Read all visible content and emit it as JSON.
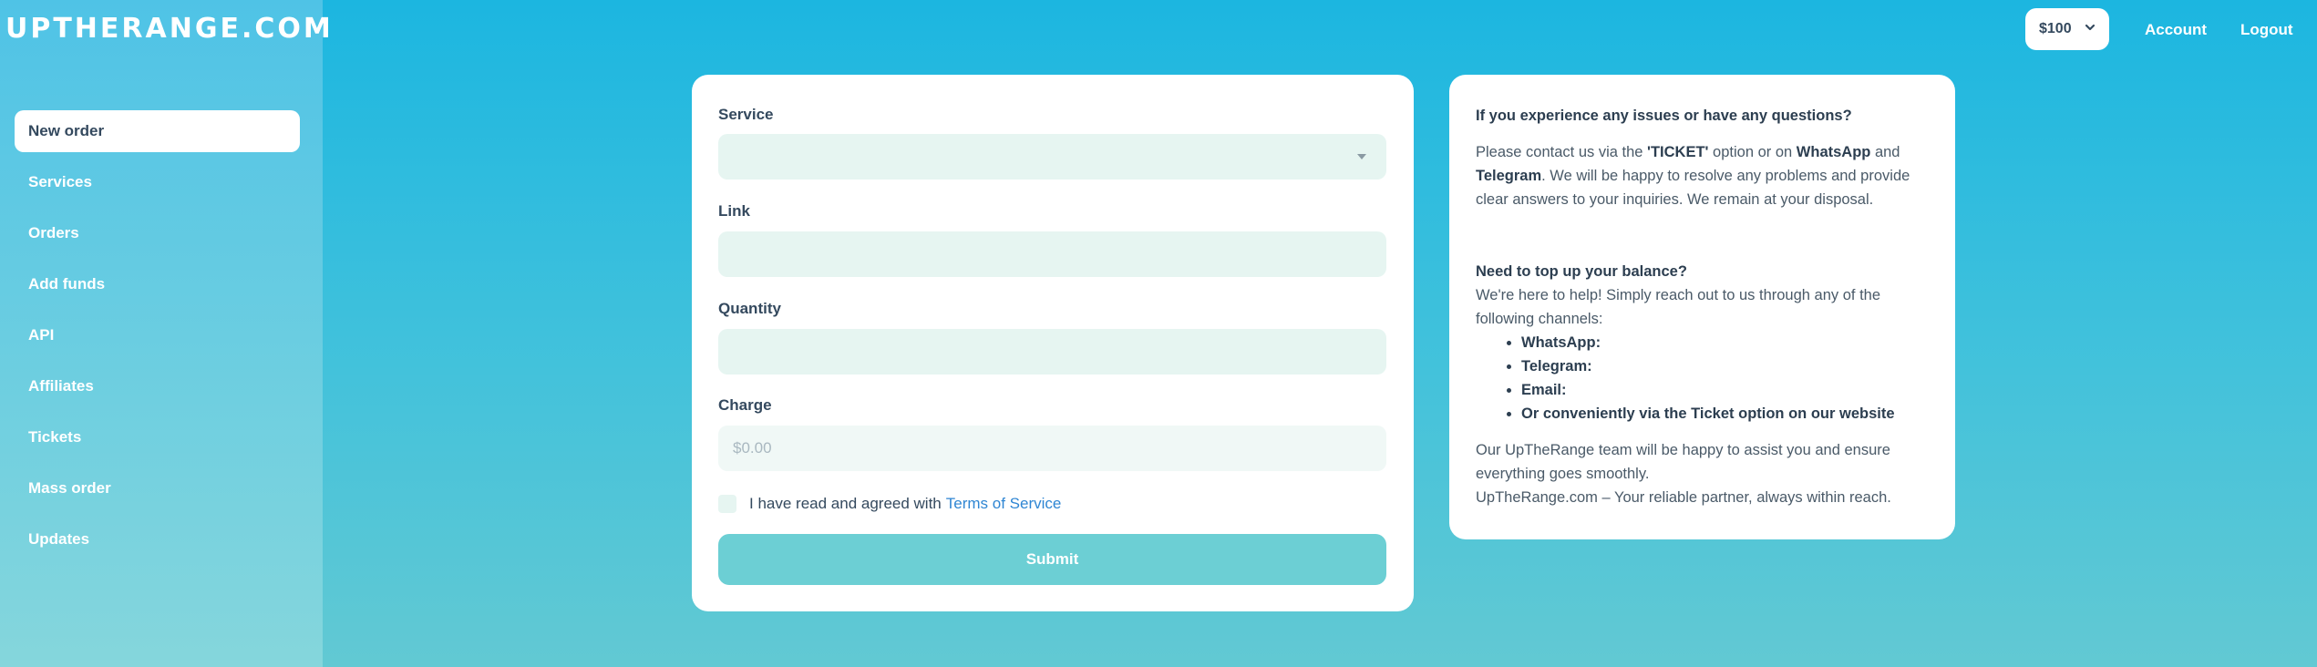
{
  "brand": {
    "logo": "UPTHERANGE.COM"
  },
  "sidebar": {
    "items": [
      {
        "label": "New order",
        "active": true
      },
      {
        "label": "Services"
      },
      {
        "label": "Orders"
      },
      {
        "label": "Add funds"
      },
      {
        "label": "API"
      },
      {
        "label": "Affiliates"
      },
      {
        "label": "Tickets"
      },
      {
        "label": "Mass order"
      },
      {
        "label": "Updates"
      }
    ]
  },
  "topbar": {
    "balance": "$100",
    "account_label": "Account",
    "logout_label": "Logout"
  },
  "order_form": {
    "service_label": "Service",
    "service_value": "",
    "link_label": "Link",
    "link_value": "",
    "quantity_label": "Quantity",
    "quantity_value": "",
    "charge_label": "Charge",
    "charge_value": "$0.00",
    "tos_text": "I have read and agreed with",
    "tos_link": "Terms of Service",
    "tos_checked": false,
    "submit_label": "Submit"
  },
  "info": {
    "heading1": "If you experience any issues or have any questions?",
    "p1_a": "Please contact us via the ",
    "p1_ticket": "'TICKET'",
    "p1_b": " option or on ",
    "p1_whatsapp": "WhatsApp",
    "p1_c": " and ",
    "p1_telegram": "Telegram",
    "p1_d": ". We will be happy to resolve any problems and provide clear answers to your inquiries. We remain at your disposal.",
    "heading2": "Need to top up your balance?",
    "p2": "We're here to help! Simply reach out to us through any of the following channels:",
    "channels": [
      "WhatsApp:",
      "Telegram:",
      "Email:",
      "Or conveniently via the Ticket option on our website"
    ],
    "p3": "Our UpTheRange team will be happy to assist you and ensure everything goes smoothly.",
    "p4": "UpTheRange.com – Your reliable partner, always within reach."
  },
  "colors": {
    "accent_bg": "#1cb6e0",
    "submit_bg": "#6ccfd4",
    "input_bg": "#e6f5f1",
    "link": "#2f86d3"
  }
}
